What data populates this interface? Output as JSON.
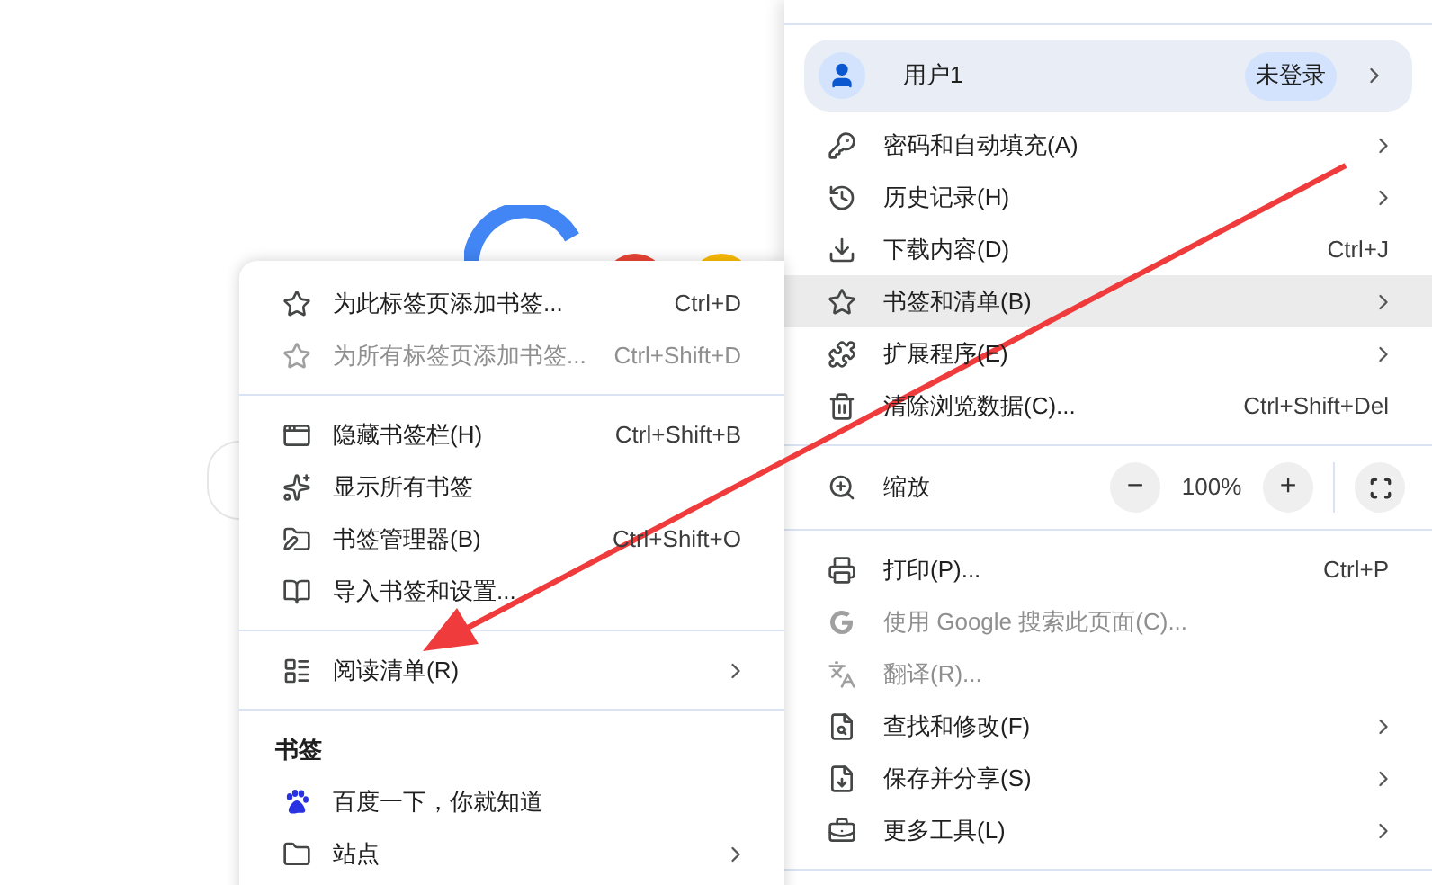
{
  "main_menu": {
    "profile": {
      "name": "用户1",
      "badge": "未登录"
    },
    "sections": [
      {
        "kind": "items",
        "items": [
          {
            "label": "密码和自动填充(A)",
            "has_submenu": true,
            "disabled": false,
            "selected": false
          },
          {
            "label": "历史记录(H)",
            "has_submenu": true,
            "disabled": false,
            "selected": false
          },
          {
            "label": "下载内容(D)",
            "shortcut": "Ctrl+J",
            "has_submenu": false,
            "disabled": false,
            "selected": false
          },
          {
            "label": "书签和清单(B)",
            "has_submenu": true,
            "disabled": false,
            "selected": true
          },
          {
            "label": "扩展程序(E)",
            "has_submenu": true,
            "disabled": false,
            "selected": false
          },
          {
            "label": "清除浏览数据(C)...",
            "shortcut": "Ctrl+Shift+Del",
            "has_submenu": false,
            "disabled": false,
            "selected": false
          }
        ]
      },
      {
        "kind": "zoom",
        "label": "缩放",
        "minus": "−",
        "value": "100%",
        "plus": "+"
      },
      {
        "kind": "items",
        "items": [
          {
            "label": "打印(P)...",
            "shortcut": "Ctrl+P",
            "has_submenu": false,
            "disabled": false,
            "selected": false
          },
          {
            "label": "使用 Google 搜索此页面(C)...",
            "has_submenu": false,
            "disabled": true,
            "selected": false
          },
          {
            "label": "翻译(R)...",
            "has_submenu": false,
            "disabled": true,
            "selected": false
          },
          {
            "label": "查找和修改(F)",
            "has_submenu": true,
            "disabled": false,
            "selected": false
          },
          {
            "label": "保存并分享(S)",
            "has_submenu": true,
            "disabled": false,
            "selected": false
          },
          {
            "label": "更多工具(L)",
            "has_submenu": true,
            "disabled": false,
            "selected": false
          }
        ]
      }
    ]
  },
  "submenu": {
    "sections": [
      {
        "items": [
          {
            "label": "为此标签页添加书签...",
            "shortcut": "Ctrl+D",
            "has_submenu": false,
            "disabled": false
          },
          {
            "label": "为所有标签页添加书签...",
            "shortcut": "Ctrl+Shift+D",
            "has_submenu": false,
            "disabled": true
          }
        ]
      },
      {
        "items": [
          {
            "label": "隐藏书签栏(H)",
            "shortcut": "Ctrl+Shift+B",
            "has_submenu": false,
            "disabled": false
          },
          {
            "label": "显示所有书签",
            "has_submenu": false,
            "disabled": false
          },
          {
            "label": "书签管理器(B)",
            "shortcut": "Ctrl+Shift+O",
            "has_submenu": false,
            "disabled": false
          },
          {
            "label": "导入书签和设置...",
            "has_submenu": false,
            "disabled": false
          }
        ]
      },
      {
        "items": [
          {
            "label": "阅读清单(R)",
            "has_submenu": true,
            "disabled": false
          }
        ]
      },
      {
        "header": "书签",
        "items": [
          {
            "label": "百度一下，你就知道",
            "has_submenu": false,
            "disabled": false
          },
          {
            "label": "站点",
            "has_submenu": true,
            "disabled": false
          }
        ]
      }
    ]
  }
}
